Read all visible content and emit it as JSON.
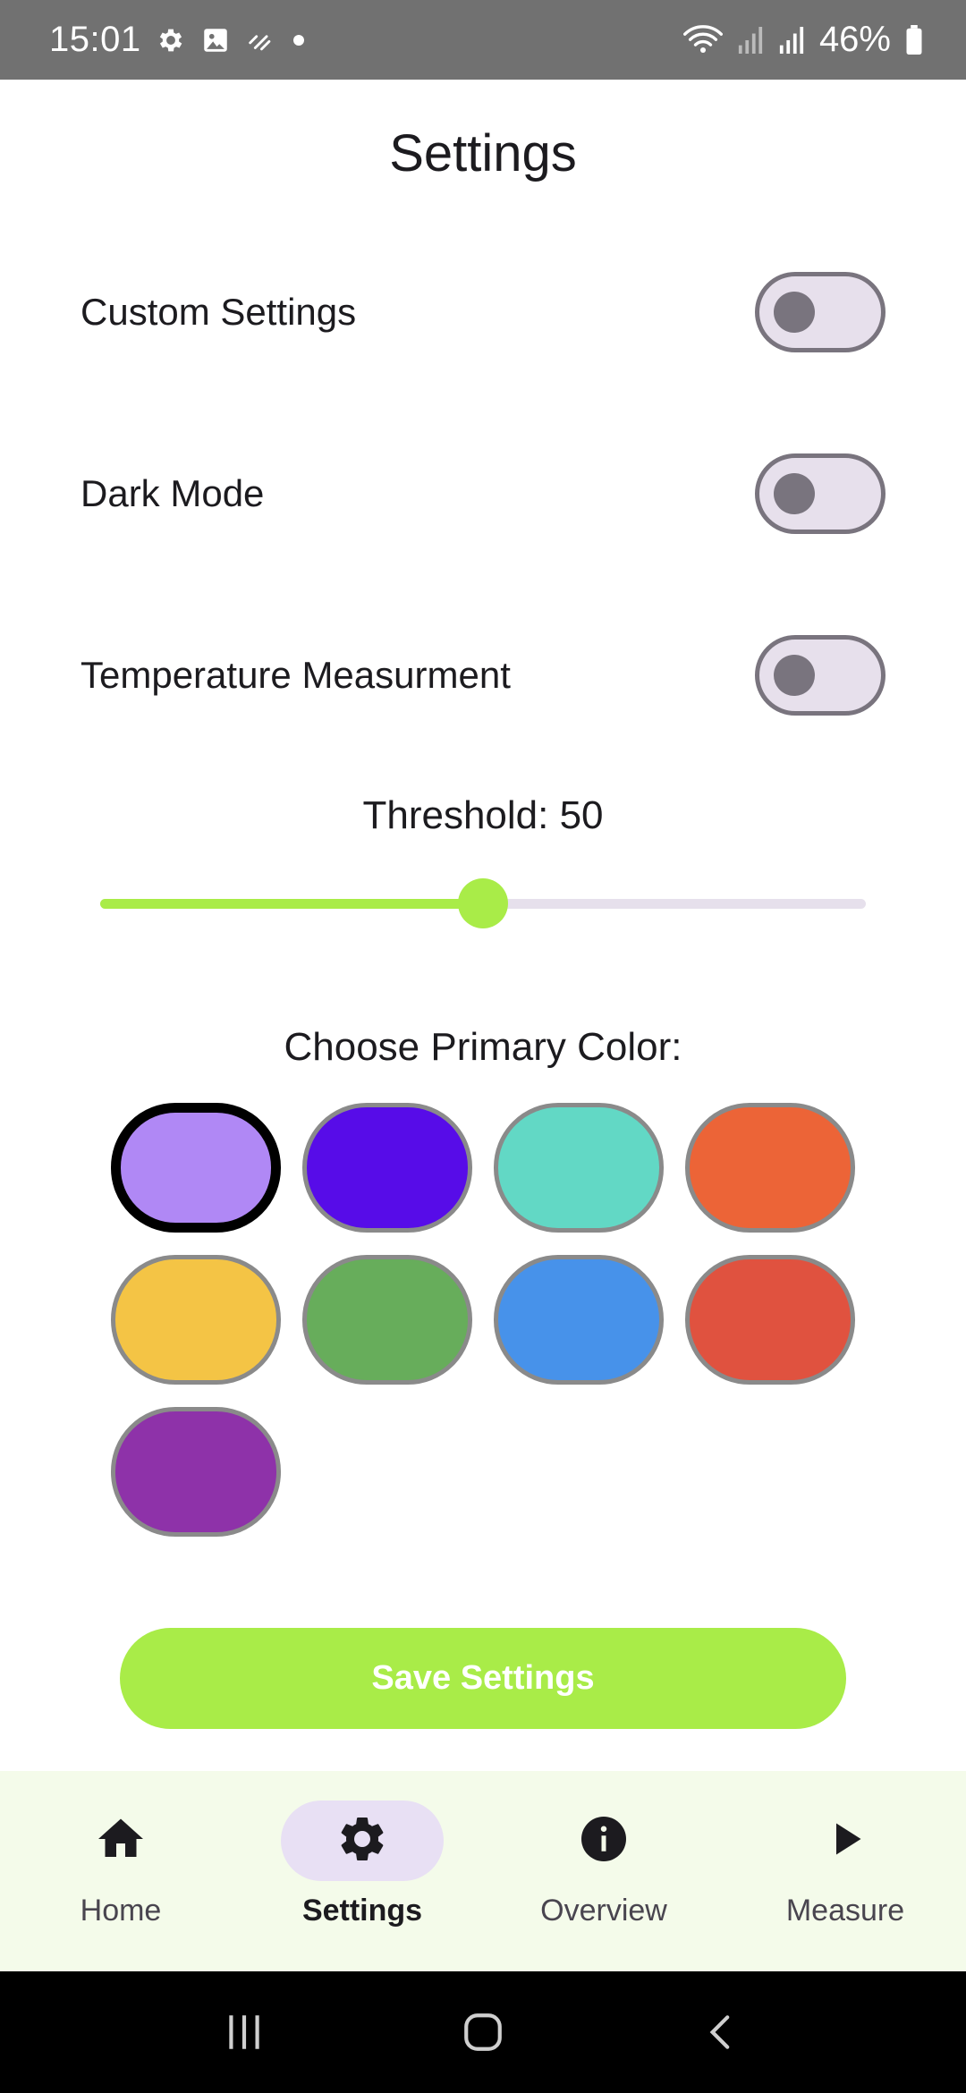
{
  "status_bar": {
    "time": "15:01",
    "battery": "46%",
    "icons": [
      "settings-icon",
      "image-icon",
      "tiles-icon",
      "dot-icon",
      "wifi-icon",
      "signal-icon",
      "signal-icon",
      "battery-icon"
    ]
  },
  "header": {
    "title": "Settings"
  },
  "settings": {
    "custom_settings": {
      "label": "Custom Settings",
      "enabled": false
    },
    "dark_mode": {
      "label": "Dark Mode",
      "enabled": false
    },
    "temperature": {
      "label": "Temperature Measurment",
      "enabled": false
    }
  },
  "threshold": {
    "label": "Threshold: 50",
    "value": 50,
    "min": 0,
    "max": 100,
    "accent": "#a9ec48"
  },
  "colors": {
    "title": "Choose Primary Color:",
    "selected_index": 0,
    "swatches": [
      "#b088f5",
      "#570ce8",
      "#62d8c5",
      "#ec6437",
      "#f4c445",
      "#67ad5b",
      "#4792ea",
      "#e0523f",
      "#8e32a9"
    ]
  },
  "save_button": {
    "label": "Save Settings",
    "color": "#a9ec48"
  },
  "nav": {
    "items": [
      {
        "label": "Home",
        "icon": "home-icon",
        "active": false
      },
      {
        "label": "Settings",
        "icon": "gear-icon",
        "active": true
      },
      {
        "label": "Overview",
        "icon": "info-icon",
        "active": false
      },
      {
        "label": "Measure",
        "icon": "play-icon",
        "active": false
      }
    ]
  },
  "system_nav": {
    "buttons": [
      "recents-icon",
      "home-outline-icon",
      "back-icon"
    ]
  }
}
